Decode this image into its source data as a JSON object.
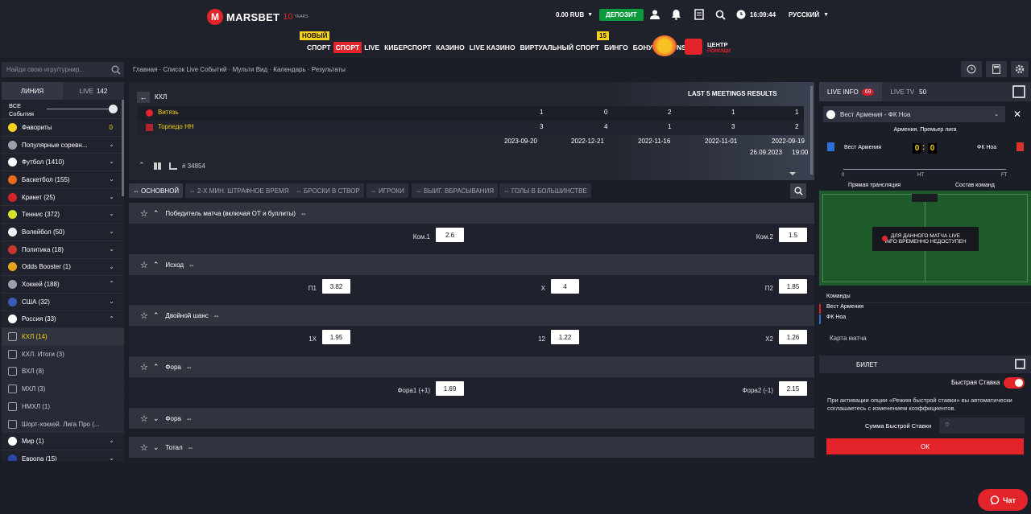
{
  "header": {
    "brand": "MARSBET",
    "brand_ten": "10",
    "brand_years": "YEARS",
    "balance": "0.00 RUB",
    "deposit": "ДЕПОЗИТ",
    "time": "16:09:44",
    "language": "РУССКИЙ",
    "badge_new": "НОВЫЙ",
    "badge_bonus": "15",
    "help_label": "ЦЕНТР",
    "help_sub": "ПОМОЩИ",
    "nav": [
      "СПОРТ",
      "СПОРТ",
      "LIVE",
      "КИБЕРСПОРТ",
      "КАЗИНО",
      "LIVE КАЗИНО",
      "ВИРТУАЛЬНЫЙ СПОРТ",
      "БИНГО",
      "БОНУС",
      "SPONSORS"
    ]
  },
  "search": {
    "placeholder": "Найди свою игру/турнир..."
  },
  "breadcrumbs": "Главная  ·  Список Live Событий  ·  Мульти Вид  ·  Календарь  ·  Результаты",
  "sidebar": {
    "tab_line": "ЛИНИЯ",
    "tab_live": "LIVE",
    "tab_live_count": "142",
    "all_events_1": "ВСЕ",
    "all_events_2": "События",
    "items": [
      {
        "label": "Фавориты",
        "count": "0",
        "color": "#f5d21b"
      },
      {
        "label": "Популярные соревн...",
        "color": "#9aa0ad"
      },
      {
        "label": "Футбол (1410)",
        "color": "#ffffff"
      },
      {
        "label": "Баскетбол (155)",
        "color": "#e86a1c"
      },
      {
        "label": "Крикет (25)",
        "color": "#d1232a"
      },
      {
        "label": "Теннис (372)",
        "color": "#d5e22c"
      },
      {
        "label": "Волейбол (50)",
        "color": "#f2f2f2"
      },
      {
        "label": "Политика (18)",
        "color": "#c7372f"
      },
      {
        "label": "Odds Booster (1)",
        "color": "#e8a41c"
      },
      {
        "label": "Хоккей (188)",
        "color": "#9aa0ad"
      },
      {
        "label": "США (32)",
        "color": "#3a5bb8"
      },
      {
        "label": "Россия (33)",
        "color": "#ffffff"
      },
      {
        "label": "КХЛ (14)",
        "color": "#666"
      },
      {
        "label": "КХЛ. Итоги (3)",
        "color": "#666"
      },
      {
        "label": "ВХЛ (8)",
        "color": "#666"
      },
      {
        "label": "МХЛ (3)",
        "color": "#666"
      },
      {
        "label": "НМХЛ (1)",
        "color": "#666"
      },
      {
        "label": "Шорт-хоккей. Лига Про (...",
        "color": "#666"
      },
      {
        "label": "Мир (1)",
        "color": "#ffffff"
      },
      {
        "label": "Европа (15)",
        "color": "#2c46a8"
      }
    ]
  },
  "match": {
    "league": "КХЛ",
    "title": "LAST 5 MEETINGS RESULTS",
    "team1": "Витязь",
    "team2": "Торпедо НН",
    "t1_scores": [
      "1",
      "0",
      "2",
      "1",
      "1"
    ],
    "t2_scores": [
      "3",
      "4",
      "1",
      "3",
      "2"
    ],
    "dates": [
      "2023-09-20",
      "2022-12-21",
      "2022-11-16",
      "2022-11-01",
      "2022-09-19"
    ],
    "start": "26.09.2023",
    "start_time": "19:00",
    "event_id": "# 34854"
  },
  "market_tabs": [
    "ОСНОВНОЙ",
    "2-Х МИН. ШТРАФНОЕ ВРЕМЯ",
    "БРОСКИ В СТВОР",
    "ИГРОКИ",
    "ВЫИГ. ВБРАСЫВАНИЯ",
    "ГОЛЫ В БОЛЬШИНСТВЕ"
  ],
  "markets": [
    {
      "title": "Победитель матча (включая ОТ и буллиты)",
      "odds": [
        {
          "label": "Ком.1",
          "value": "2.6"
        },
        {
          "label": "Ком.2",
          "value": "1.5"
        }
      ]
    },
    {
      "title": "Исход",
      "odds": [
        {
          "label": "П1",
          "value": "3.82"
        },
        {
          "label": "Х",
          "value": "4"
        },
        {
          "label": "П2",
          "value": "1.85"
        }
      ]
    },
    {
      "title": "Двойной шанс",
      "odds": [
        {
          "label": "1Х",
          "value": "1.95"
        },
        {
          "label": "12",
          "value": "1.22"
        },
        {
          "label": "Х2",
          "value": "1.26"
        }
      ]
    },
    {
      "title": "Фора",
      "odds": [
        {
          "label": "Фора1 (+1)",
          "value": "1.69"
        },
        {
          "label": "Фора2 (-1)",
          "value": "2.15"
        }
      ]
    },
    {
      "title": "Фора"
    },
    {
      "title": "Тотал"
    }
  ],
  "right": {
    "live_info": "LIVE INFO",
    "live_info_count": "69",
    "live_tv": "LIVE TV",
    "live_tv_count": "50",
    "event": "Вест Армения - ФК Ноа",
    "league": "Армения. Премьер лига",
    "home": "Вест Армения",
    "away": "ФК Ноа",
    "score_home": "0",
    "score_away": "0",
    "timeline_start": "0",
    "timeline_ht": "HT",
    "timeline_ft": "FT",
    "broadcast": "Прямая трансляция",
    "lineups": "Состав команд",
    "field_msg1": "ДЛЯ ДАННОГО МАТЧА LIVE",
    "field_msg2": "INFO ВРЕМЕННО НЕДОСТУПЕН",
    "teams_label": "Команды",
    "team_a": "Вест Армения",
    "team_b": "ФК Ноа",
    "match_card": "Карта матча",
    "ticket": "БИЛЕТ",
    "quick_bet": "Быстрая Ставка",
    "quick_text": "При активации опции «Режим быстрой ставки» вы автоматически соглашаетесь с изменением коэффициентов.",
    "quick_sum_label": "Сумма Быстрой Ставки",
    "quick_sum_value": "0",
    "ok": "ОК"
  },
  "chat": "Чат"
}
